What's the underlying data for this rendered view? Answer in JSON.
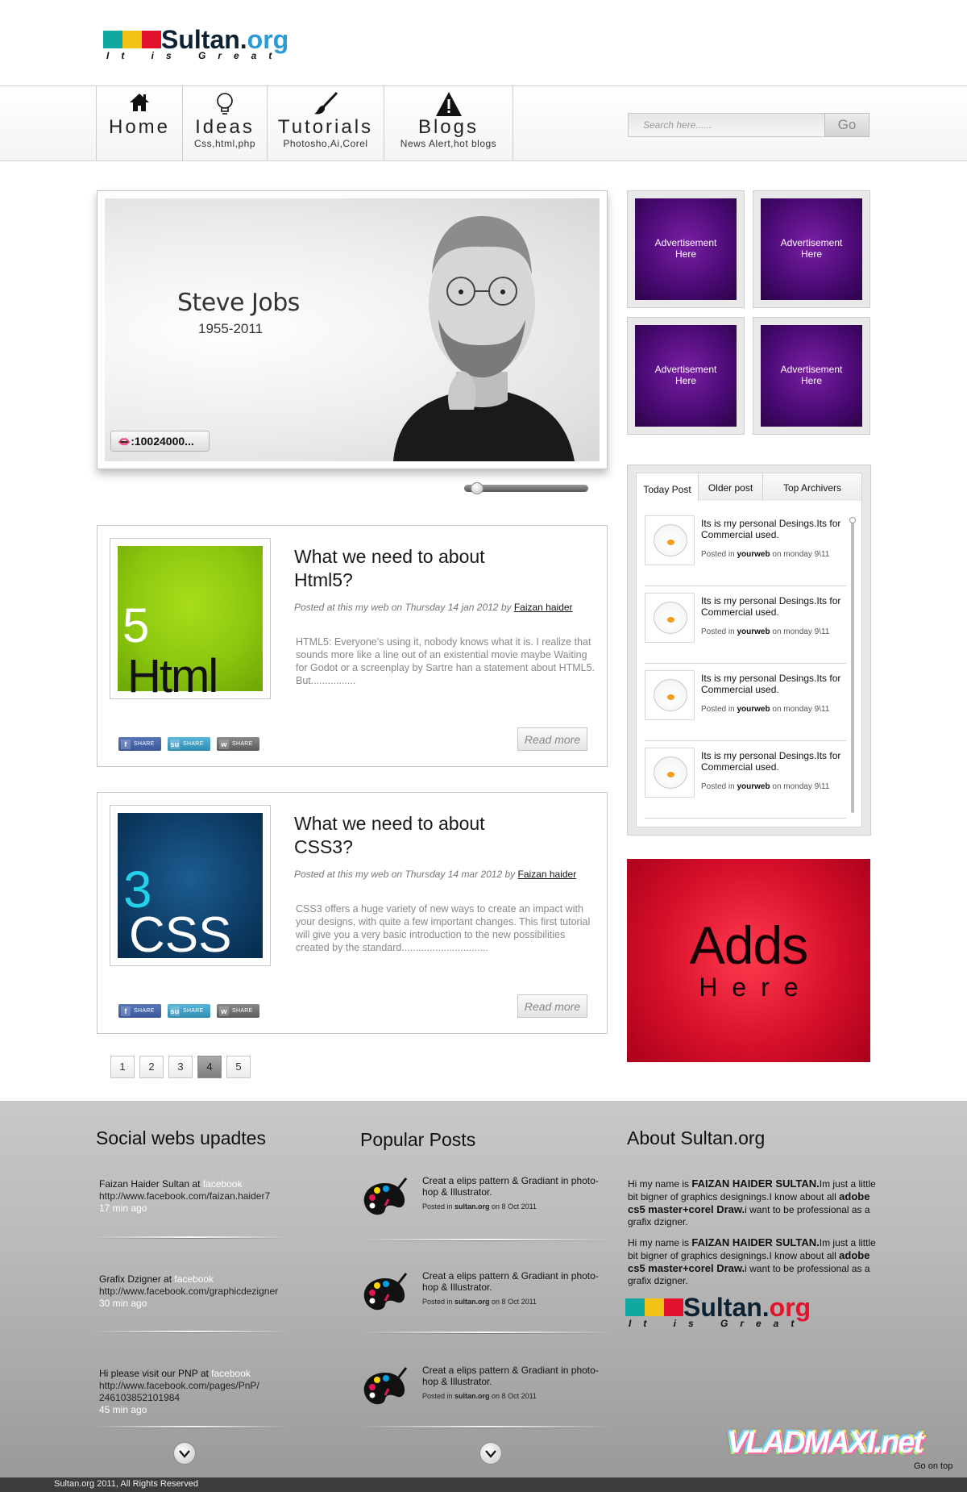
{
  "brand": {
    "name_main": "Sultan.",
    "name_ext": "org",
    "tagline": "It is Great",
    "colors": [
      "#0fa9a1",
      "#f1c317",
      "#e2122c"
    ]
  },
  "nav": [
    {
      "label": "Home",
      "sub": "",
      "icon": "home-icon"
    },
    {
      "label": "Ideas",
      "sub": "Css,html,php",
      "icon": "lightbulb-icon"
    },
    {
      "label": "Tutorials",
      "sub": "Photosho,Ai,Corel",
      "icon": "brush-icon"
    },
    {
      "label": "Blogs",
      "sub": "News Alert,hot blogs",
      "icon": "warning-icon"
    }
  ],
  "search": {
    "placeholder": "Search here......",
    "button": "Go"
  },
  "hero": {
    "name": "Steve Jobs",
    "years": "1955-2011",
    "counter": ":10024000..."
  },
  "ads": {
    "label_line1": "Advertisement",
    "label_line2": "Here"
  },
  "tabs": {
    "items": [
      "Today Post",
      "Older post",
      "Top Archivers"
    ],
    "active": "Today Post",
    "posts": [
      {
        "text": "Its is my personal Desings.Its for Commercial used.",
        "posted_in": "Posted in",
        "site": "yourweb",
        "date": "on monday 9\\11"
      },
      {
        "text": "Its is my personal Desings.Its for Commercial used.",
        "posted_in": "Posted in",
        "site": "yourweb",
        "date": "on monday 9\\11"
      },
      {
        "text": "Its is my personal Desings.Its for Commercial used.",
        "posted_in": "Posted in",
        "site": "yourweb",
        "date": "on monday 9\\11"
      },
      {
        "text": "Its is my personal Desings.Its for Commercial used.",
        "posted_in": "Posted in",
        "site": "yourweb",
        "date": "on monday 9\\11"
      }
    ]
  },
  "bigad": {
    "line1": "Adds",
    "line2": "Here"
  },
  "articles": [
    {
      "image_text": "Html",
      "image_accent": "5",
      "title_line1": "What we need to about",
      "title_line2": "Html5?",
      "meta": "Posted at this my web  on Thursday 14 jan 2012 by ",
      "author": "Faizan haider",
      "body": "HTML5: Everyone's using it, nobody knows what it is. I realize that sounds more like a line out of an existential movie  maybe Waiting for Godot or a screenplay by Sartre  han a statement  about HTML5. But................",
      "read_more": "Read more"
    },
    {
      "image_text": "CSS",
      "image_accent": "3",
      "title_line1": "What we need to about",
      "title_line2": "CSS3?",
      "meta": "Posted at this my web  on Thursday 14 mar 2012 by ",
      "author": "Faizan haider",
      "body": "CSS3 offers a huge variety of new ways to create an impact with your designs, with quite a few important changes. This first tutorial will give you a very basic introduction to the new possibilities created by the standard...............................",
      "read_more": "Read more"
    }
  ],
  "share_label": "SHARE",
  "pagination": {
    "pages": [
      "1",
      "2",
      "3",
      "4",
      "5"
    ],
    "active": "4"
  },
  "footer": {
    "social_title": "Social webs upadtes",
    "social": [
      {
        "who": "Faizan Haider Sultan at ",
        "site": "facebook",
        "url": "http://www.facebook.com/faizan.haider7",
        "url2": "",
        "ago": "17 min ago"
      },
      {
        "who": "Grafix Dzigner  at ",
        "site": "facebook",
        "url": "http://www.facebook.com/graphicdezigner",
        "url2": "",
        "ago": "30 min ago"
      },
      {
        "who": "Hi please visit our PNP at ",
        "site": "facebook",
        "url": "http://www.facebook.com/pages/PnP/",
        "url2": "246103852101984",
        "ago": "45 min ago"
      }
    ],
    "popular_title": "Popular Posts",
    "popular": [
      {
        "text": "Creat a elips pattern & Gradiant  in photo-hop & Illustrator.",
        "posted_in": "Posted in ",
        "site": "sultan.org",
        "date": " on 8 Oct 2011"
      },
      {
        "text": "Creat a elips pattern & Gradiant  in photo-hop & Illustrator.",
        "posted_in": "Posted in ",
        "site": "sultan.org",
        "date": " on 8 Oct 2011"
      },
      {
        "text": "Creat a elips pattern & Gradiant  in photo-hop & Illustrator.",
        "posted_in": "Posted in ",
        "site": "sultan.org",
        "date": " on 8 Oct 2011"
      }
    ],
    "about_title": "About Sultan.org",
    "about_paragraphs": [
      {
        "a": "Hi my name  is ",
        "name": "FAIZAN HAIDER SULTAN.",
        "b": "Im just a little bit bigner of graphics designings.I know about all ",
        "skills": "adobe cs5 master+corel Draw.",
        "c": "i want to be professional as a grafix dzigner."
      },
      {
        "a": "Hi my name  is ",
        "name": "FAIZAN HAIDER SULTAN.",
        "b": "Im just a little bit bigner of graphics designings.I know about all ",
        "skills": "adobe cs5 master+corel Draw.",
        "c": "i want to be professional as a grafix dzigner."
      }
    ],
    "watermark": "VLADMAXI.net",
    "go_top": "Go on top",
    "copyright": "Sultan.org 2011,  All Rights Reserved"
  }
}
